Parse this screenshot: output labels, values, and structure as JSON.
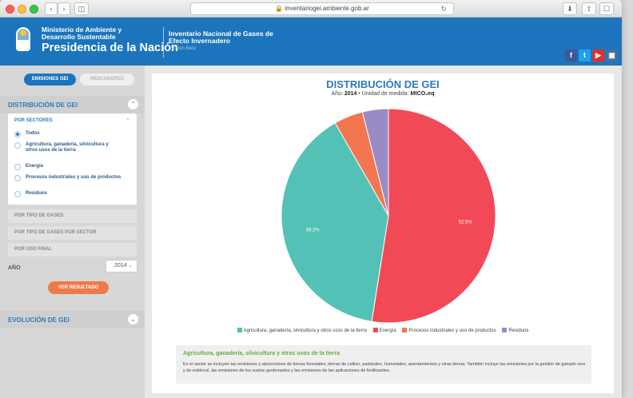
{
  "browser": {
    "url": "inventariogei.ambiente.gob.ar"
  },
  "header": {
    "ministry": "Ministerio de Ambiente y Desarrollo Sustentable",
    "presidencia": "Presidencia de la Nación",
    "inventory_title": "Inventario Nacional de Gases de Efecto Invernadero",
    "version": "Versión Beta",
    "social": [
      "facebook",
      "twitter",
      "youtube",
      "instagram"
    ]
  },
  "sidebar": {
    "tabs": [
      "EMISIONES GEI",
      "INDICADORES"
    ],
    "distribucion_label": "DISTRIBUCIÓN DE GEI",
    "por_sectores": "POR SECTORES",
    "options": [
      "Todos",
      "Agricultura, ganadería, silvicultura y otros usos de la tierra",
      "Energía",
      "Procesos industriales y uso de productos",
      "Residuos"
    ],
    "selected_option": 0,
    "groups": [
      "POR TIPO DE GASES",
      "POR TIPO DE GASES POR SECTOR",
      "POR USO FINAL"
    ],
    "anio_label": "AÑO",
    "anio_value": "2014",
    "ver_resultado": "VER RESULTADO",
    "evolucion_label": "EVOLUCIÓN DE GEI"
  },
  "chart": {
    "title": "DISTRIBUCIÓN DE GEI",
    "subtitle_prefix": "Año:",
    "subtitle_year": "2014",
    "subtitle_mid": "• Unidad de medida:",
    "subtitle_unit": "MtCO₂eq",
    "slice_labels": [
      "52.5%",
      "39.2%"
    ]
  },
  "chart_data": {
    "type": "pie",
    "title": "DISTRIBUCIÓN DE GEI",
    "categories": [
      "Energía",
      "Agricultura, ganadería, silvicultura y otros usos de la tierra",
      "Procesos industriales y uso de productos",
      "Residuos"
    ],
    "values": [
      52.5,
      39.2,
      4.4,
      3.9
    ],
    "colors": [
      "#f24957",
      "#54c1b6",
      "#f47650",
      "#9b8bc4"
    ],
    "legend_placement": "bottom"
  },
  "description": {
    "title": "Agricultura, ganadería, silvicultura y otros usos de la tierra",
    "text": "En el sector se incluyen las emisiones y absorciones de tierras forestales, tierras de cultivo, pastizales, humedales, asentamientos y otras tierras. También incluye las emisiones por la gestión de ganado vivo y de estiércol, las emisiones de los suelos gestionados y las emisiones de las aplicaciones de fertilizantes."
  },
  "colors": {
    "header_blue": "#1c75bc",
    "accent_orange": "#ee7a4a",
    "desc_green": "#6aaa3a"
  }
}
